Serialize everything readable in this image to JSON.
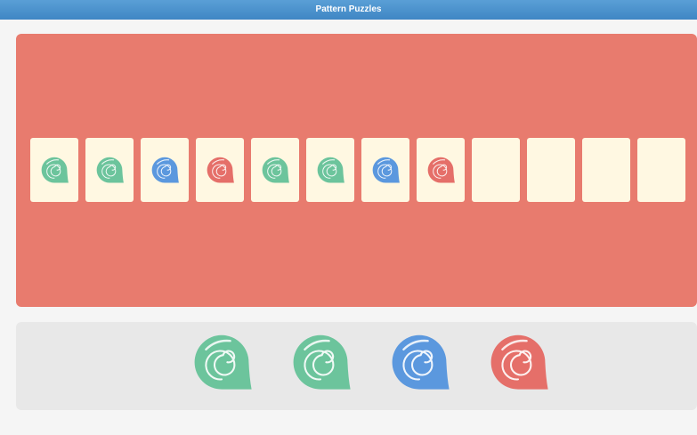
{
  "app": {
    "title": "Pattern Puzzles"
  },
  "colors": {
    "titlebar": "#4a93cf",
    "board": "#e87b6e",
    "card": "#fff8e2",
    "tray": "#e8e8e8",
    "green": "#6cc49c",
    "blue": "#5b98de",
    "red": "#e56f69"
  },
  "sequence": [
    "green",
    "green",
    "blue",
    "red",
    "green",
    "green",
    "blue",
    "red",
    "empty",
    "empty",
    "empty",
    "empty"
  ],
  "choices": [
    "green",
    "green",
    "blue",
    "red"
  ]
}
